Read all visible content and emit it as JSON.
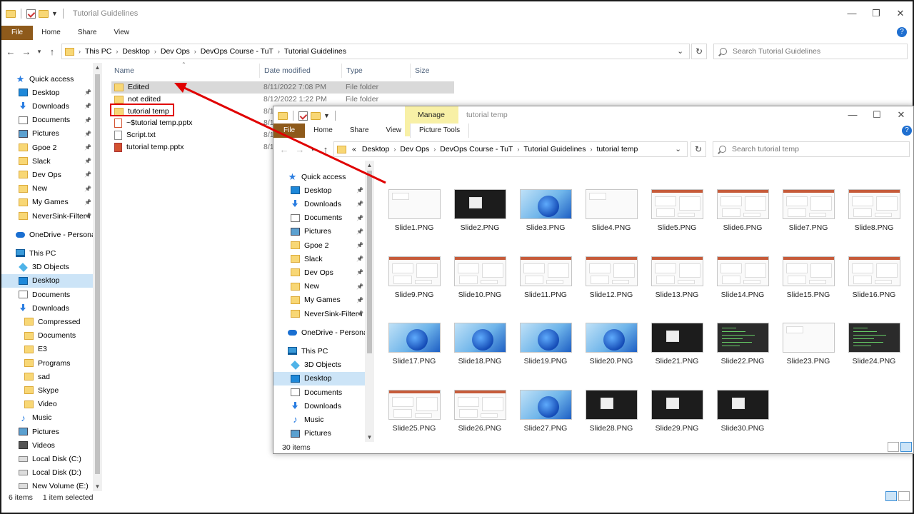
{
  "window1": {
    "title": "Tutorial Guidelines",
    "ribbon_tabs": [
      "File",
      "Home",
      "Share",
      "View"
    ],
    "path": [
      "This PC",
      "Desktop",
      "Dev Ops",
      "DevOps Course - TuT",
      "Tutorial Guidelines"
    ],
    "search_placeholder": "Search Tutorial Guidelines",
    "columns": [
      "Name",
      "Date modified",
      "Type",
      "Size"
    ],
    "files": [
      {
        "name": "Edited",
        "date": "8/11/2022 7:08 PM",
        "type": "File folder",
        "icon": "folder-icon",
        "selected": true
      },
      {
        "name": "not edited",
        "date": "8/12/2022 1:22 PM",
        "type": "File folder",
        "icon": "folder-icon"
      },
      {
        "name": "tutorial temp",
        "date": "8/1",
        "type": "",
        "icon": "folder-icon",
        "highlighted": true
      },
      {
        "name": "~$tutorial temp.pptx",
        "date": "8/1",
        "type": "",
        "icon": "pptx-temp-icon"
      },
      {
        "name": "Script.txt",
        "date": "8/1",
        "type": "",
        "icon": "text-file-icon"
      },
      {
        "name": "tutorial temp.pptx",
        "date": "8/1",
        "type": "",
        "icon": "pptx-icon"
      }
    ],
    "nav": [
      {
        "label": "Quick access",
        "icon": "star-icon",
        "indent": 0
      },
      {
        "label": "Desktop",
        "icon": "desktop-icon",
        "indent": 1,
        "pin": true
      },
      {
        "label": "Downloads",
        "icon": "download-icon",
        "indent": 1,
        "pin": true
      },
      {
        "label": "Documents",
        "icon": "document-icon",
        "indent": 1,
        "pin": true
      },
      {
        "label": "Pictures",
        "icon": "pictures-icon",
        "indent": 1,
        "pin": true
      },
      {
        "label": "Gpoe 2",
        "icon": "folder-icon",
        "indent": 1,
        "pin": true
      },
      {
        "label": "Slack",
        "icon": "folder-icon",
        "indent": 1,
        "pin": true
      },
      {
        "label": "Dev Ops",
        "icon": "folder-icon",
        "indent": 1,
        "pin": true
      },
      {
        "label": "New",
        "icon": "folder-icon",
        "indent": 1,
        "pin": true
      },
      {
        "label": "My Games",
        "icon": "folder-icon",
        "indent": 1,
        "pin": true
      },
      {
        "label": "NeverSink-Filter-I",
        "icon": "folder-icon",
        "indent": 1,
        "pin": true
      },
      {
        "label": "",
        "icon": "",
        "indent": 0,
        "spacer": true
      },
      {
        "label": "OneDrive - Personal",
        "icon": "cloud-icon",
        "indent": 0
      },
      {
        "label": "",
        "icon": "",
        "indent": 0,
        "spacer": true
      },
      {
        "label": "This PC",
        "icon": "pc-icon",
        "indent": 0
      },
      {
        "label": "3D Objects",
        "icon": "3d-objects-icon",
        "indent": 1
      },
      {
        "label": "Desktop",
        "icon": "desktop-icon",
        "indent": 1,
        "selected": true
      },
      {
        "label": "Documents",
        "icon": "document-icon",
        "indent": 1
      },
      {
        "label": "Downloads",
        "icon": "download-icon",
        "indent": 1
      },
      {
        "label": "Compressed",
        "icon": "folder-icon",
        "indent": 2
      },
      {
        "label": "Documents",
        "icon": "folder-icon",
        "indent": 2
      },
      {
        "label": "E3",
        "icon": "folder-icon",
        "indent": 2
      },
      {
        "label": "Programs",
        "icon": "folder-icon",
        "indent": 2
      },
      {
        "label": "sad",
        "icon": "folder-icon",
        "indent": 2
      },
      {
        "label": "Skype",
        "icon": "folder-icon",
        "indent": 2
      },
      {
        "label": "Video",
        "icon": "folder-icon",
        "indent": 2
      },
      {
        "label": "Music",
        "icon": "music-icon",
        "indent": 1
      },
      {
        "label": "Pictures",
        "icon": "pictures-icon",
        "indent": 1
      },
      {
        "label": "Videos",
        "icon": "video-icon",
        "indent": 1
      },
      {
        "label": "Local Disk (C:)",
        "icon": "disk-icon",
        "indent": 1
      },
      {
        "label": "Local Disk (D:)",
        "icon": "disk-icon",
        "indent": 1
      },
      {
        "label": "New Volume (E:)",
        "icon": "disk-icon",
        "indent": 1
      }
    ],
    "status_count": "6 items",
    "status_selected": "1 item selected"
  },
  "window2": {
    "title": "tutorial temp",
    "manage_label": "Manage",
    "picture_tools_label": "Picture Tools",
    "ribbon_tabs": [
      "File",
      "Home",
      "Share",
      "View"
    ],
    "path_prefix": "«",
    "path": [
      "Desktop",
      "Dev Ops",
      "DevOps Course - TuT",
      "Tutorial Guidelines",
      "tutorial temp"
    ],
    "search_placeholder": "Search tutorial temp",
    "nav": [
      {
        "label": "Quick access",
        "icon": "star-icon",
        "indent": 0
      },
      {
        "label": "Desktop",
        "icon": "desktop-icon",
        "indent": 1,
        "pin": true
      },
      {
        "label": "Downloads",
        "icon": "download-icon",
        "indent": 1,
        "pin": true
      },
      {
        "label": "Documents",
        "icon": "document-icon",
        "indent": 1,
        "pin": true
      },
      {
        "label": "Pictures",
        "icon": "pictures-icon",
        "indent": 1,
        "pin": true
      },
      {
        "label": "Gpoe 2",
        "icon": "folder-icon",
        "indent": 1,
        "pin": true
      },
      {
        "label": "Slack",
        "icon": "folder-icon",
        "indent": 1,
        "pin": true
      },
      {
        "label": "Dev Ops",
        "icon": "folder-icon",
        "indent": 1,
        "pin": true
      },
      {
        "label": "New",
        "icon": "folder-icon",
        "indent": 1,
        "pin": true
      },
      {
        "label": "My Games",
        "icon": "folder-icon",
        "indent": 1,
        "pin": true
      },
      {
        "label": "NeverSink-Filter-I",
        "icon": "folder-icon",
        "indent": 1,
        "pin": true
      },
      {
        "label": "",
        "icon": "",
        "indent": 0,
        "spacer": true
      },
      {
        "label": "OneDrive - Personal",
        "icon": "cloud-icon",
        "indent": 0
      },
      {
        "label": "",
        "icon": "",
        "indent": 0,
        "spacer": true
      },
      {
        "label": "This PC",
        "icon": "pc-icon",
        "indent": 0
      },
      {
        "label": "3D Objects",
        "icon": "3d-objects-icon",
        "indent": 1
      },
      {
        "label": "Desktop",
        "icon": "desktop-icon",
        "indent": 1,
        "selected": true
      },
      {
        "label": "Documents",
        "icon": "document-icon",
        "indent": 1
      },
      {
        "label": "Downloads",
        "icon": "download-icon",
        "indent": 1
      },
      {
        "label": "Music",
        "icon": "music-icon",
        "indent": 1
      },
      {
        "label": "Pictures",
        "icon": "pictures-icon",
        "indent": 1
      }
    ],
    "slides": [
      {
        "label": "Slide1.PNG",
        "style": "blank"
      },
      {
        "label": "Slide2.PNG",
        "style": "dark"
      },
      {
        "label": "Slide3.PNG",
        "style": "win11"
      },
      {
        "label": "Slide4.PNG",
        "style": "blank"
      },
      {
        "label": "Slide5.PNG",
        "style": "ppt"
      },
      {
        "label": "Slide6.PNG",
        "style": "ppt"
      },
      {
        "label": "Slide7.PNG",
        "style": "ppt"
      },
      {
        "label": "Slide8.PNG",
        "style": "ppt"
      },
      {
        "label": "Slide9.PNG",
        "style": "ppt"
      },
      {
        "label": "Slide10.PNG",
        "style": "ppt"
      },
      {
        "label": "Slide11.PNG",
        "style": "ppt"
      },
      {
        "label": "Slide12.PNG",
        "style": "ppt"
      },
      {
        "label": "Slide13.PNG",
        "style": "ppt"
      },
      {
        "label": "Slide14.PNG",
        "style": "ppt"
      },
      {
        "label": "Slide15.PNG",
        "style": "ppt"
      },
      {
        "label": "Slide16.PNG",
        "style": "ppt"
      },
      {
        "label": "Slide17.PNG",
        "style": "win11"
      },
      {
        "label": "Slide18.PNG",
        "style": "win11"
      },
      {
        "label": "Slide19.PNG",
        "style": "win11"
      },
      {
        "label": "Slide20.PNG",
        "style": "win11"
      },
      {
        "label": "Slide21.PNG",
        "style": "dark"
      },
      {
        "label": "Slide22.PNG",
        "style": "term"
      },
      {
        "label": "Slide23.PNG",
        "style": "blank"
      },
      {
        "label": "Slide24.PNG",
        "style": "term"
      },
      {
        "label": "Slide25.PNG",
        "style": "ppt"
      },
      {
        "label": "Slide26.PNG",
        "style": "ppt"
      },
      {
        "label": "Slide27.PNG",
        "style": "win11"
      },
      {
        "label": "Slide28.PNG",
        "style": "dark"
      },
      {
        "label": "Slide29.PNG",
        "style": "dark"
      },
      {
        "label": "Slide30.PNG",
        "style": "dark"
      }
    ],
    "status_count": "30 items"
  },
  "annotation": {
    "color": "#e00000"
  }
}
